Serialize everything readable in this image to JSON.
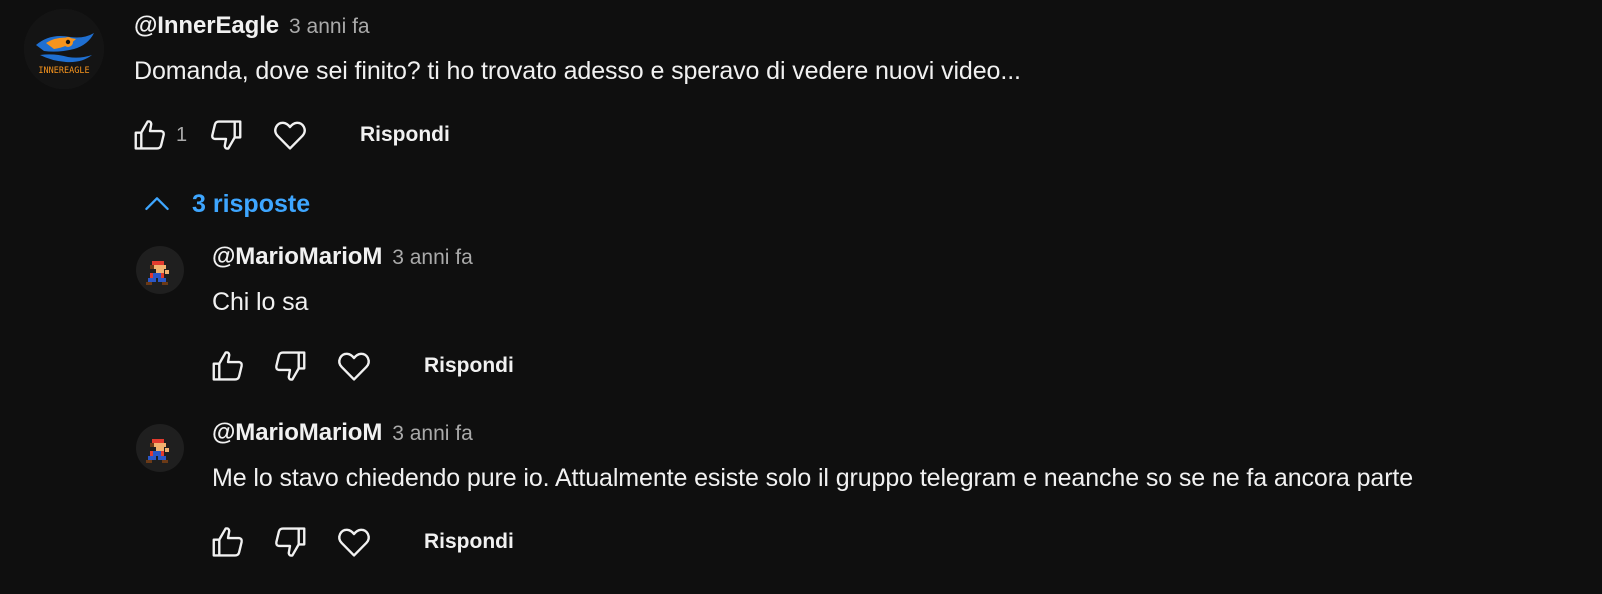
{
  "comments": [
    {
      "author": "@InnerEagle",
      "time": "3 anni fa",
      "text": "Domanda, dove sei finito? ti ho trovato adesso e speravo di vedere nuovi video...",
      "likes": "1",
      "reply_label": "Rispondi",
      "avatar_text": "INNEREAGLE"
    }
  ],
  "replies_toggle": {
    "label": "3 risposte"
  },
  "replies": [
    {
      "author": "@MarioMarioM",
      "time": "3 anni fa",
      "text": "Chi lo sa",
      "reply_label": "Rispondi"
    },
    {
      "author": "@MarioMarioM",
      "time": "3 anni fa",
      "text": "Me lo stavo chiedendo pure io. Attualmente esiste solo il gruppo telegram e neanche so se ne fa ancora parte",
      "reply_label": "Rispondi"
    }
  ],
  "colors": {
    "background": "#0f0f0f",
    "text": "#f1f1f1",
    "secondary": "#aaaaaa",
    "link": "#3ea6ff",
    "eagle_orange": "#f7941d",
    "eagle_blue": "#1f6fd1"
  },
  "icons": [
    "like-icon",
    "dislike-icon",
    "heart-icon",
    "chevron-up-icon"
  ]
}
